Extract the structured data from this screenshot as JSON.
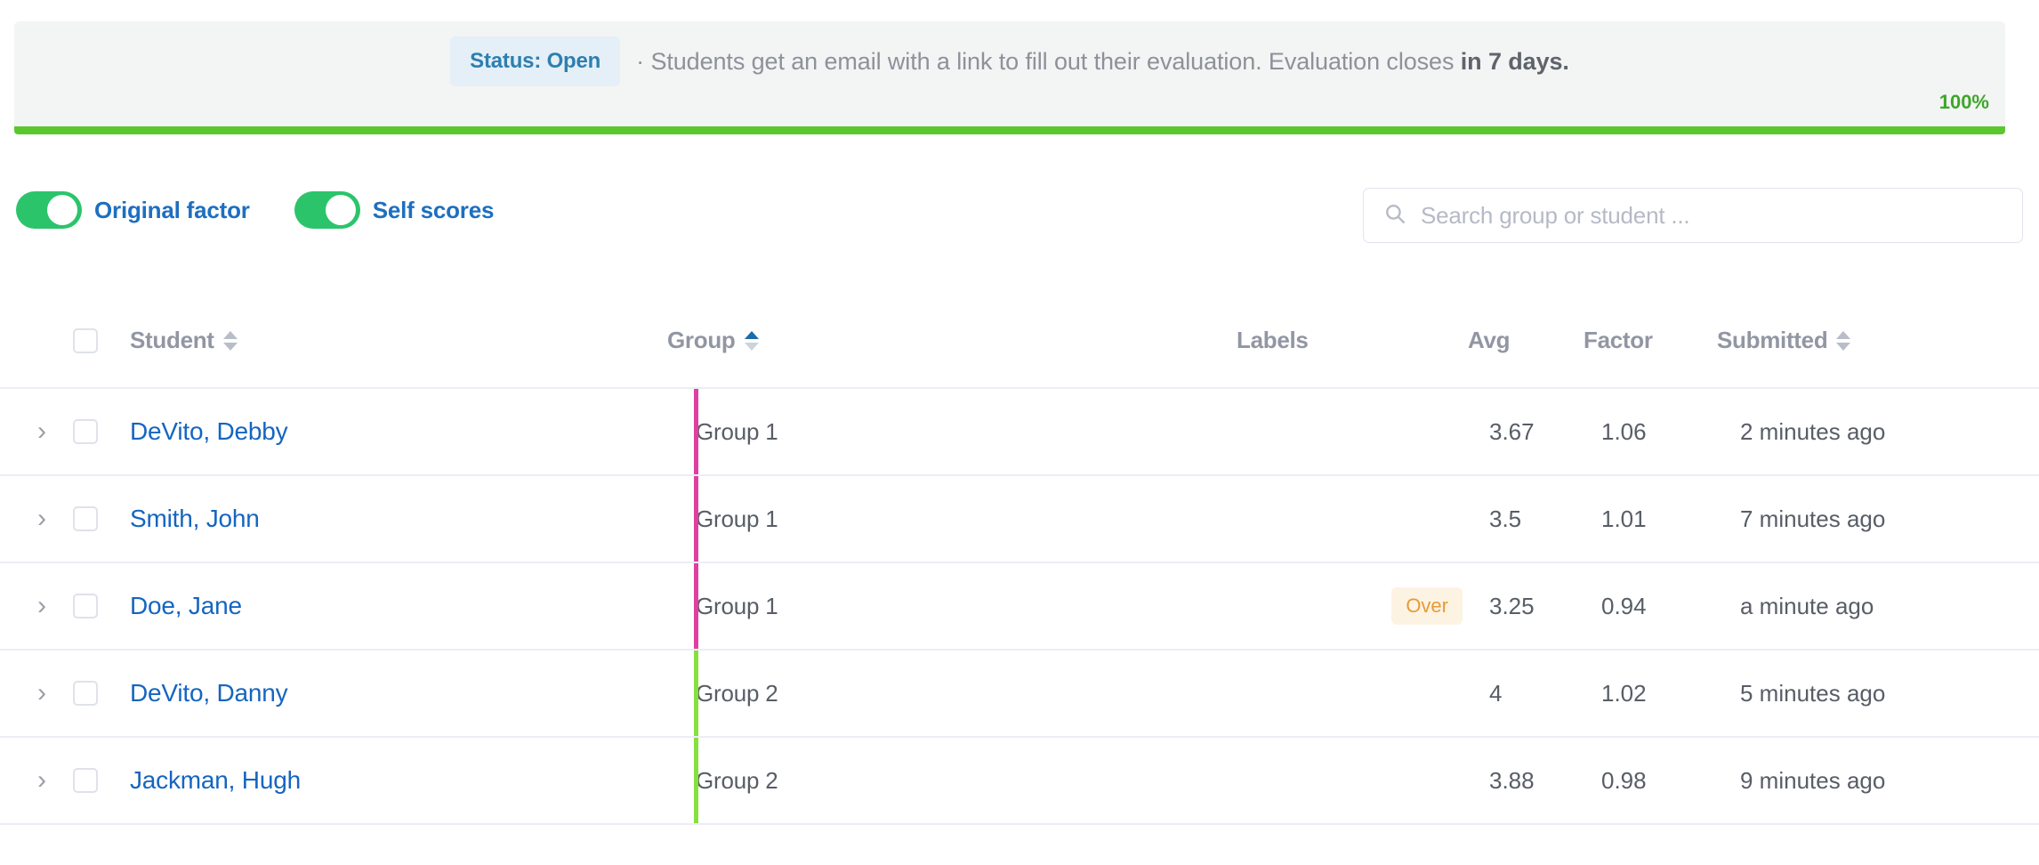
{
  "banner": {
    "status_pill": "Status: Open",
    "separator": "·",
    "message_prefix": "Students get an email with a link to fill out their evaluation. Evaluation closes ",
    "message_strong": "in 7 days.",
    "progress_percent_label": "100%",
    "progress_value": 100,
    "progress_color": "#5bc72c",
    "pill_bg": "#e4eff7",
    "pill_text_color": "#2d7fb0"
  },
  "toolbar": {
    "toggles": [
      {
        "label": "Original factor",
        "on": true,
        "icon": "toggle-switch-icon"
      },
      {
        "label": "Self scores",
        "on": true,
        "icon": "toggle-switch-icon"
      }
    ],
    "search": {
      "placeholder": "Search group or student ...",
      "value": "",
      "icon": "search-icon"
    },
    "toggle_on_color": "#2bc46b",
    "toggle_label_color": "#1d6fc0"
  },
  "table": {
    "columns": [
      {
        "key": "student",
        "label": "Student",
        "sortable": true,
        "sort": "none"
      },
      {
        "key": "group",
        "label": "Group",
        "sortable": true,
        "sort": "asc"
      },
      {
        "key": "labels",
        "label": "Labels",
        "sortable": false,
        "sort": "none"
      },
      {
        "key": "avg",
        "label": "Avg",
        "sortable": false,
        "sort": "none"
      },
      {
        "key": "factor",
        "label": "Factor",
        "sortable": false,
        "sort": "none"
      },
      {
        "key": "submitted",
        "label": "Submitted",
        "sortable": true,
        "sort": "none"
      }
    ],
    "select_all_checked": false,
    "rows": [
      {
        "expand_icon": "chevron-right-icon",
        "checked": false,
        "student": "DeVito, Debby",
        "group": "Group 1",
        "group_color": "#e13fa0",
        "label": "",
        "avg": "3.67",
        "factor": "1.06",
        "submitted": "2 minutes ago"
      },
      {
        "expand_icon": "chevron-right-icon",
        "checked": false,
        "student": "Smith, John",
        "group": "Group 1",
        "group_color": "#e13fa0",
        "label": "",
        "avg": "3.5",
        "factor": "1.01",
        "submitted": "7 minutes ago"
      },
      {
        "expand_icon": "chevron-right-icon",
        "checked": false,
        "student": "Doe, Jane",
        "group": "Group 1",
        "group_color": "#e13fa0",
        "label": "Over",
        "avg": "3.25",
        "factor": "0.94",
        "submitted": "a minute ago"
      },
      {
        "expand_icon": "chevron-right-icon",
        "checked": false,
        "student": "DeVito, Danny",
        "group": "Group 2",
        "group_color": "#86e03e",
        "label": "",
        "avg": "4",
        "factor": "1.02",
        "submitted": "5 minutes ago"
      },
      {
        "expand_icon": "chevron-right-icon",
        "checked": false,
        "student": "Jackman, Hugh",
        "group": "Group 2",
        "group_color": "#86e03e",
        "label": "",
        "avg": "3.88",
        "factor": "0.98",
        "submitted": "9 minutes ago"
      }
    ],
    "label_badge_bg": "#fdf3e3",
    "label_badge_color": "#e89a36",
    "student_link_color": "#1565c0",
    "row_divider_color": "#eceef6"
  }
}
